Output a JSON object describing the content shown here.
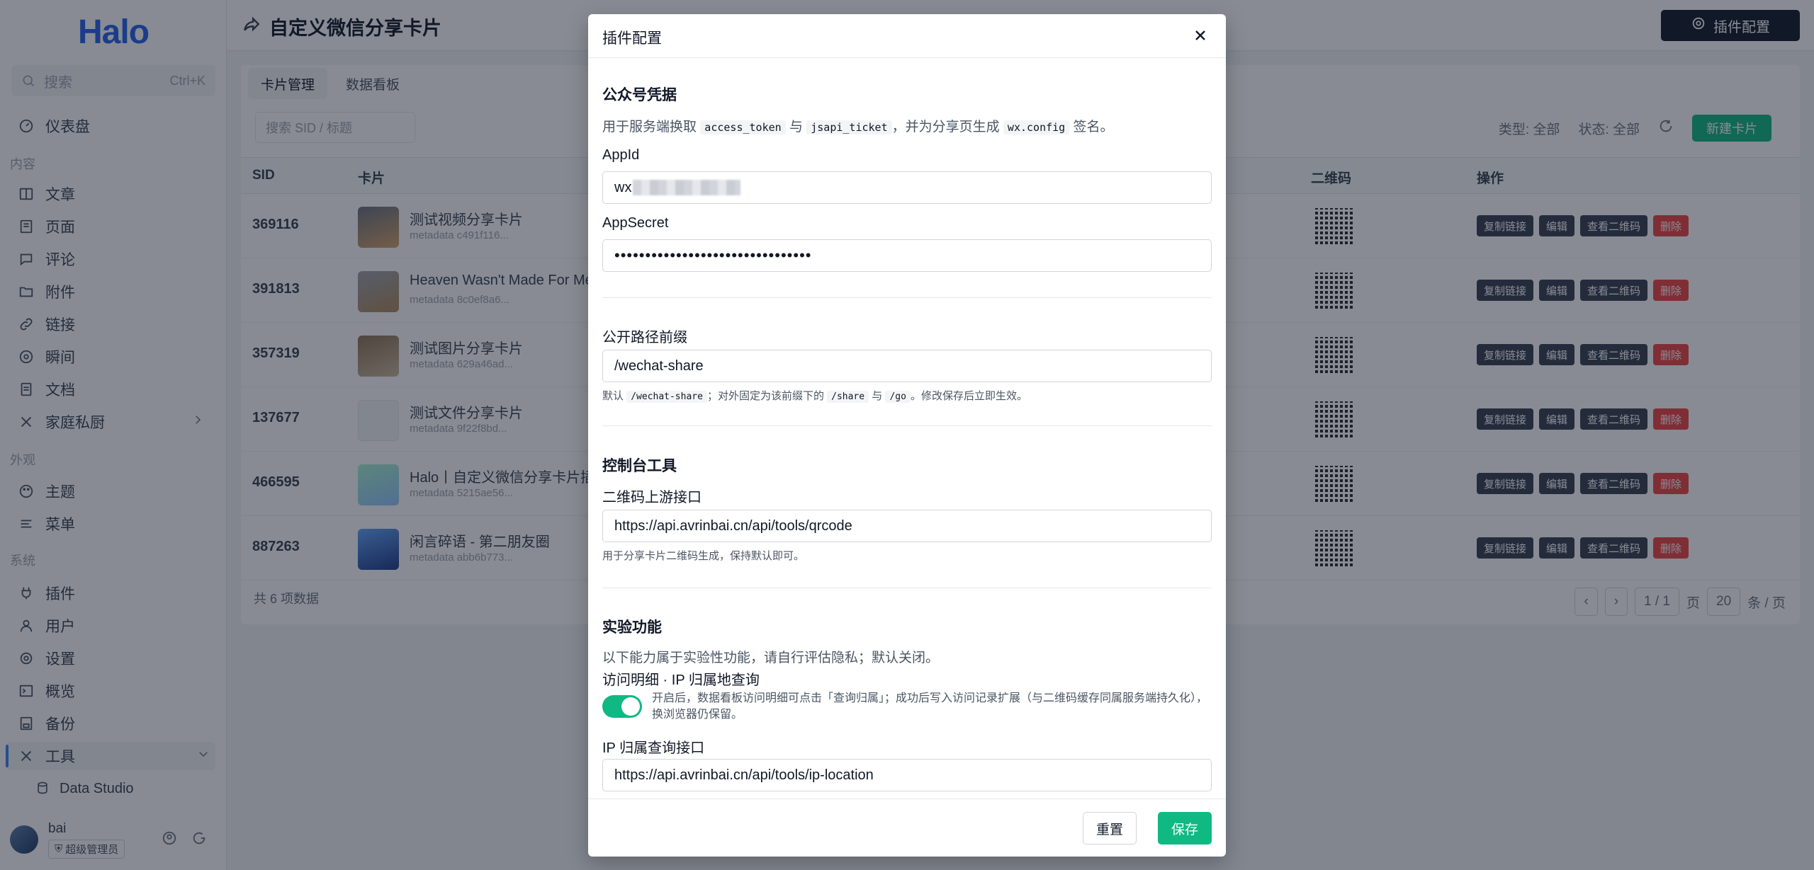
{
  "app": {
    "logo": "Halo"
  },
  "sidebar": {
    "search_placeholder": "搜索",
    "search_shortcut": "Ctrl+K",
    "dashboard": "仪表盘",
    "group_content": "内容",
    "content_items": [
      "文章",
      "页面",
      "评论",
      "附件",
      "链接",
      "瞬间",
      "文档",
      "家庭私厨"
    ],
    "group_appearance": "外观",
    "appearance_items": [
      "主题",
      "菜单"
    ],
    "group_system": "系统",
    "system_items": [
      "插件",
      "用户",
      "设置",
      "概览",
      "备份",
      "工具"
    ],
    "tools_sub": "Data Studio",
    "user_name": "bai",
    "user_role": "超级管理员"
  },
  "topbar": {
    "title": "自定义微信分享卡片",
    "plugin_config": "插件配置"
  },
  "main": {
    "tabs": [
      "卡片管理",
      "数据看板"
    ],
    "search_placeholder": "搜索 SID / 标题",
    "filter_type": "类型: 全部",
    "filter_status": "状态: 全部",
    "new_card": "新建卡片",
    "columns": {
      "sid": "SID",
      "card": "卡片",
      "qr": "二维码",
      "ops": "操作"
    },
    "rows": [
      {
        "sid": "369116",
        "title": "测试视频分享卡片",
        "meta": "metadata c491f116..."
      },
      {
        "sid": "391813",
        "title": "Heaven Wasn't Made For Me",
        "meta": "metadata 8c0ef8a6..."
      },
      {
        "sid": "357319",
        "title": "测试图片分享卡片",
        "meta": "metadata 629a46ad..."
      },
      {
        "sid": "137677",
        "title": "测试文件分享卡片",
        "meta": "metadata 9f22f8bd..."
      },
      {
        "sid": "466595",
        "title": "Halo丨自定义微信分享卡片插件",
        "meta": "metadata 5215ae56..."
      },
      {
        "sid": "887263",
        "title": "闲言碎语 - 第二朋友圈",
        "meta": "metadata abb6b773..."
      }
    ],
    "row_actions": [
      "复制链接",
      "编辑",
      "查看二维码",
      "删除"
    ],
    "total": "共 6 项数据",
    "pager": {
      "page": "1 / 1",
      "page_unit": "页",
      "size": "20",
      "size_unit": "条 / 页"
    }
  },
  "modal": {
    "title": "插件配置",
    "sec_credentials": "公众号凭据",
    "cred_desc_1": "用于服务端换取",
    "cred_code_1": "access_token",
    "cred_desc_2": "与",
    "cred_code_2": "jsapi_ticket",
    "cred_desc_3": "，并为分享页生成",
    "cred_code_3": "wx.config",
    "cred_desc_4": "签名。",
    "appid_label": "AppId",
    "appid_value": "wx",
    "appsecret_label": "AppSecret",
    "appsecret_value": "••••••••••••••••••••••••••••••••",
    "prefix_label": "公开路径前缀",
    "prefix_value": "/wechat-share",
    "prefix_desc_1": "默认",
    "prefix_code_1": "/wechat-share",
    "prefix_desc_2": "；对外固定为该前缀下的",
    "prefix_code_2": "/share",
    "prefix_desc_3": "与",
    "prefix_code_3": "/go",
    "prefix_desc_4": "。修改保存后立即生效。",
    "sec_console": "控制台工具",
    "qr_api_label": "二维码上游接口",
    "qr_api_value": "https://api.avrinbai.cn/api/tools/qrcode",
    "qr_api_desc": "用于分享卡片二维码生成，保持默认即可。",
    "sec_experimental": "实验功能",
    "exp_desc": "以下能力属于实验性功能，请自行评估隐私；默认关闭。",
    "visit_label": "访问明细 · IP 归属地查询",
    "visit_desc": "开启后，数据看板访问明细可点击「查询归属」；成功后写入访问记录扩展（与二维码缓存同属服务端持久化），换浏览器仍保留。",
    "ip_api_label": "IP 归属查询接口",
    "ip_api_value": "https://api.avrinbai.cn/api/tools/ip-location",
    "btn_reset": "重置",
    "btn_save": "保存"
  }
}
